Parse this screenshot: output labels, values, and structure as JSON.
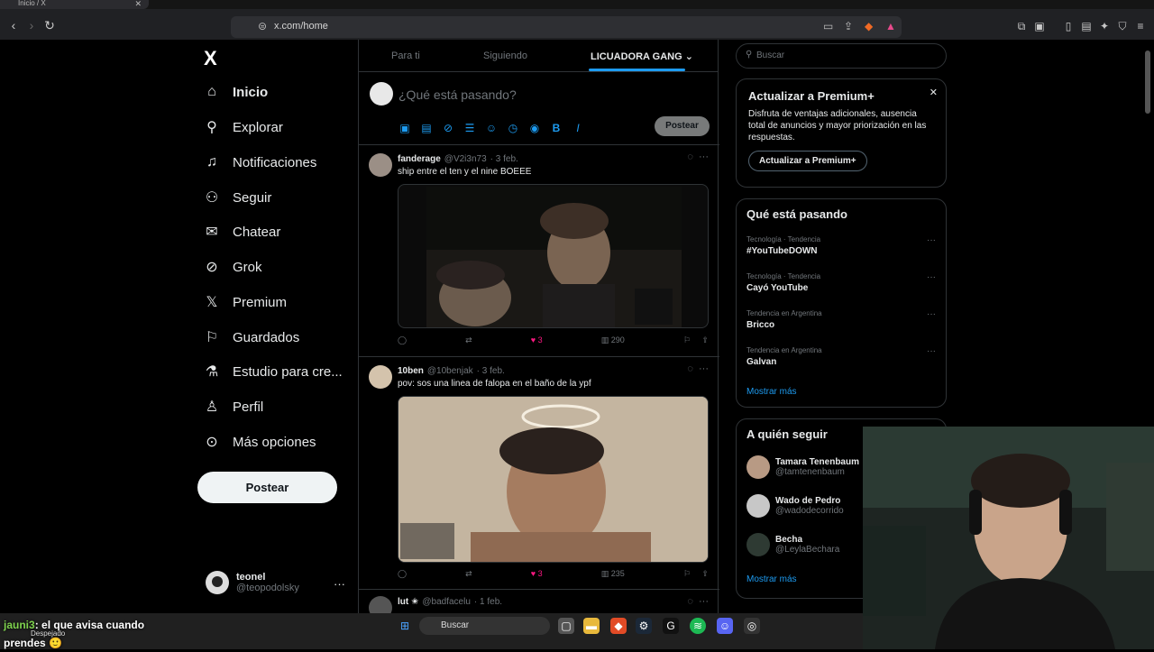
{
  "browser": {
    "tab_title": "Inicio / X",
    "url": "x.com/home"
  },
  "sidebar": {
    "logo": "X",
    "items": [
      {
        "label": "Inicio",
        "icon": "home-icon"
      },
      {
        "label": "Explorar",
        "icon": "search-icon"
      },
      {
        "label": "Notificaciones",
        "icon": "bell-icon"
      },
      {
        "label": "Seguir",
        "icon": "person-add-icon"
      },
      {
        "label": "Chatear",
        "icon": "mail-icon"
      },
      {
        "label": "Grok",
        "icon": "grok-icon"
      },
      {
        "label": "Premium",
        "icon": "x-logo-icon"
      },
      {
        "label": "Guardados",
        "icon": "bookmark-icon"
      },
      {
        "label": "Estudio para cre...",
        "icon": "flask-icon"
      },
      {
        "label": "Perfil",
        "icon": "profile-icon"
      },
      {
        "label": "Más opciones",
        "icon": "more-circle-icon"
      }
    ],
    "post_button": "Postear",
    "profile": {
      "name": "teonel",
      "handle": "@teopodolsky"
    }
  },
  "feed": {
    "tabs": [
      "Para ti",
      "Siguiendo",
      "LICUADORA GANG"
    ],
    "compose_placeholder": "¿Qué está pasando?",
    "compose_post": "Postear",
    "tweets": [
      {
        "name": "fanderage",
        "handle": "@V2i3n73",
        "date": "· 3 feb.",
        "text": "ship entre el ten y el nine BOEEE",
        "likes": "3",
        "views": "290"
      },
      {
        "name": "10ben",
        "handle": "@10benjak",
        "date": "· 3 feb.",
        "text": "pov: sos una linea de falopa en el baño de la ypf",
        "likes": "3",
        "views": "235"
      },
      {
        "name": "lut ✬",
        "handle": "@badfacelu",
        "date": "· 1 feb.",
        "text": "",
        "likes": "",
        "views": ""
      }
    ]
  },
  "right": {
    "search_placeholder": "Buscar",
    "premium": {
      "title": "Actualizar a Premium+",
      "text": "Disfruta de ventajas adicionales, ausencia total de anuncios y mayor priorización en las respuestas.",
      "button": "Actualizar a Premium+"
    },
    "trends": {
      "title": "Qué está pasando",
      "items": [
        {
          "category": "Tecnología · Tendencia",
          "name": "#YouTubeDOWN"
        },
        {
          "category": "Tecnología · Tendencia",
          "name": "Cayó YouTube"
        },
        {
          "category": "Tendencia en Argentina",
          "name": "Bricco"
        },
        {
          "category": "Tendencia en Argentina",
          "name": "Galvan"
        }
      ],
      "more": "Mostrar más"
    },
    "follow": {
      "title": "A quién seguir",
      "items": [
        {
          "name": "Tamara Tenenbaum",
          "handle": "@tamtenenbaum"
        },
        {
          "name": "Wado de Pedro",
          "handle": "@wadodecorrido"
        },
        {
          "name": "Becha",
          "handle": "@LeylaBechara"
        }
      ],
      "more": "Mostrar más"
    }
  },
  "taskbar": {
    "search": "Buscar"
  },
  "stream_chat": {
    "user": "jauni3",
    "message": ": el que avisa cuando",
    "message2": "prendes",
    "overlay": "Despejado"
  },
  "colors": {
    "accent": "#1d9bf0",
    "like": "#f91880",
    "background": "#000000"
  }
}
